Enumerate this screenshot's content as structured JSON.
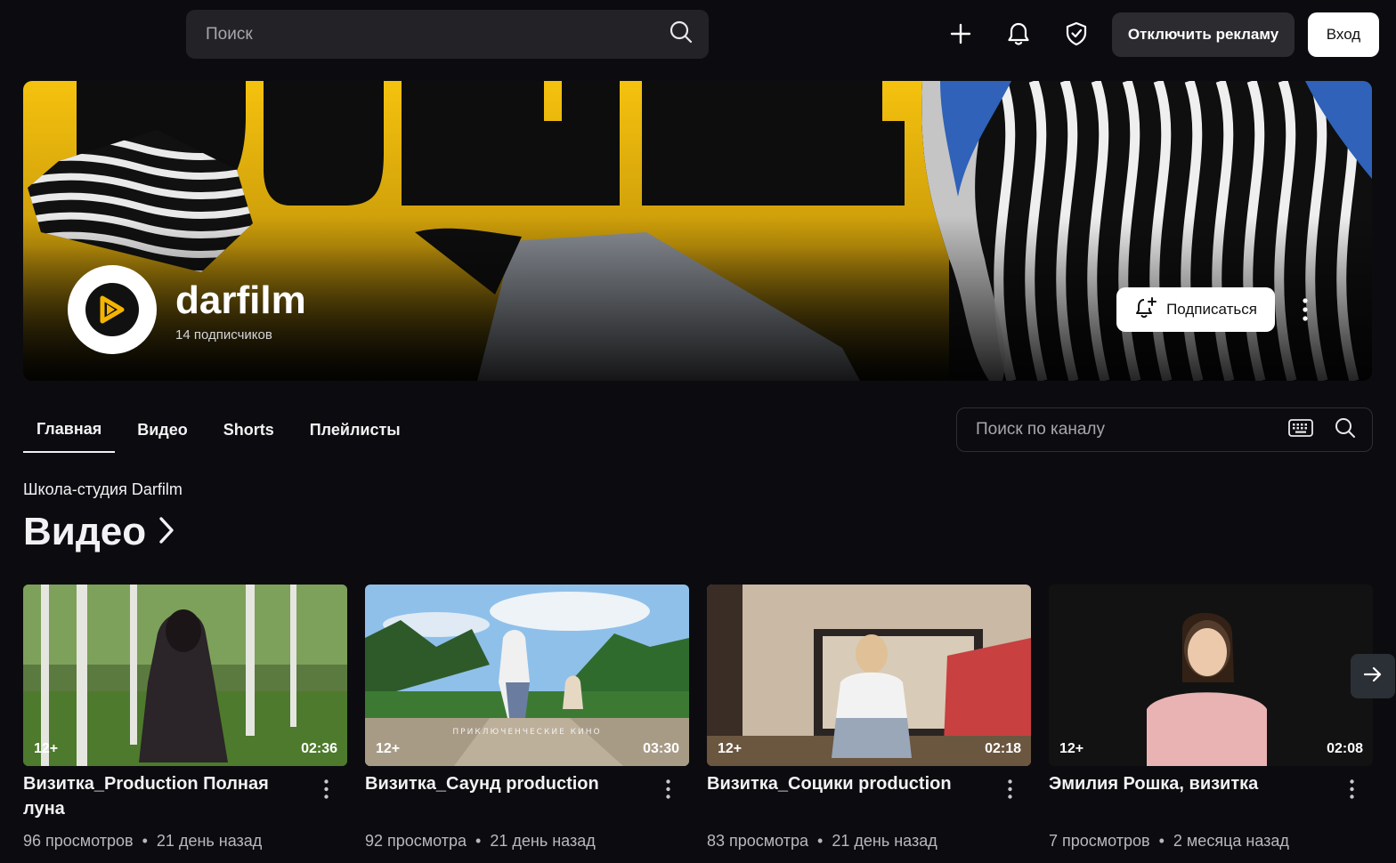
{
  "header": {
    "search_placeholder": "Поиск",
    "no_ads_label": "Отключить рекламу",
    "login_label": "Вход"
  },
  "channel": {
    "name": "darfilm",
    "subscribers": "14 подписчиков",
    "subscribe_label": "Подписаться"
  },
  "tabs": [
    {
      "label": "Главная"
    },
    {
      "label": "Видео"
    },
    {
      "label": "Shorts"
    },
    {
      "label": "Плейлисты"
    }
  ],
  "channel_search_placeholder": "Поиск по каналу",
  "section": {
    "subtitle": "Школа-студия Darfilm",
    "title": "Видео"
  },
  "videos": [
    {
      "title": "Визитка_Production Полная луна",
      "age": "12+",
      "duration": "02:36",
      "views": "96 просмотров",
      "posted": "21 день назад"
    },
    {
      "title": "Визитка_Саунд production",
      "age": "12+",
      "duration": "03:30",
      "views": "92 просмотра",
      "posted": "21 день назад",
      "overlay": "ПРИКЛЮЧЕНЧЕСКИЕ КИНО"
    },
    {
      "title": "Визитка_Социки production",
      "age": "12+",
      "duration": "02:18",
      "views": "83 просмотра",
      "posted": "21 день назад"
    },
    {
      "title": "Эмилия Рошка, визитка",
      "age": "12+",
      "duration": "02:08",
      "views": "7 просмотров",
      "posted": "2 месяца назад"
    }
  ]
}
